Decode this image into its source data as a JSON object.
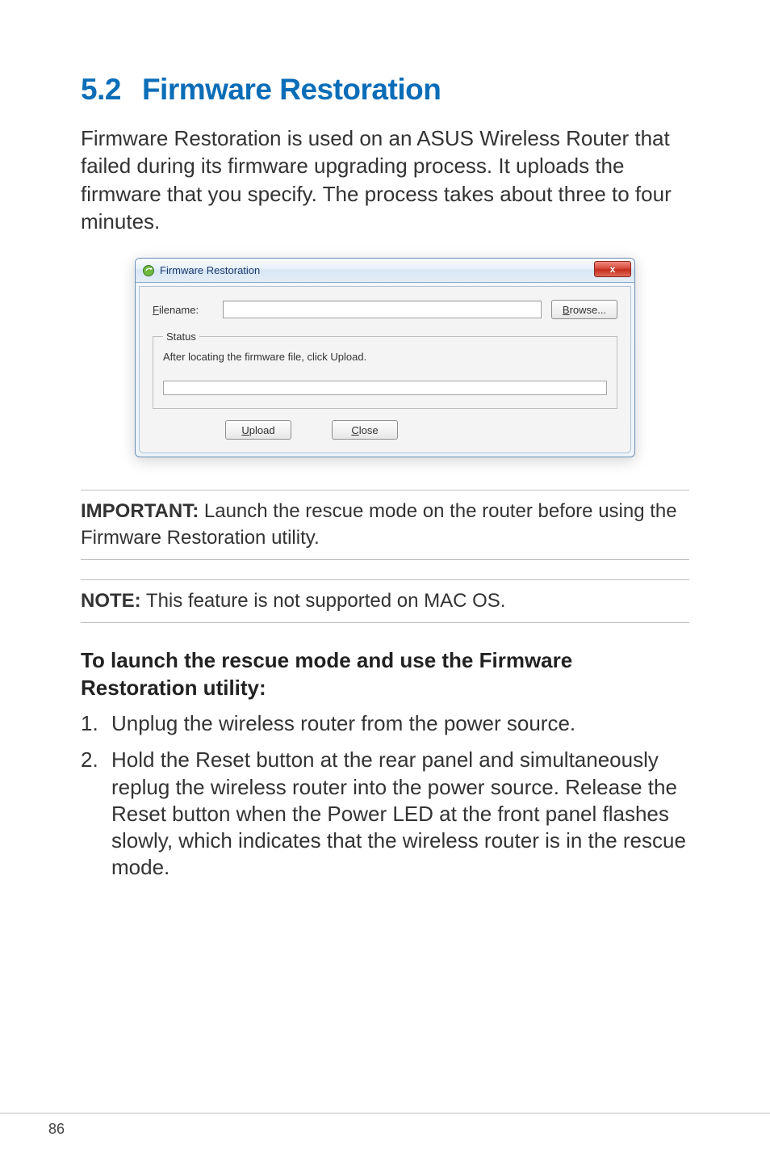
{
  "heading": {
    "number": "5.2",
    "title": "Firmware Restoration"
  },
  "intro": "Firmware Restoration is used on an ASUS Wireless Router that failed during its firmware upgrading process. It uploads the firmware that you specify. The process takes about three to four minutes.",
  "dialog": {
    "title": "Firmware Restoration",
    "close_glyph": "x",
    "filename_label_pre": "F",
    "filename_label_post": "ilename:",
    "filename_value": "",
    "browse_pre": "B",
    "browse_post": "rowse...",
    "status_legend": "Status",
    "status_text": "After locating the firmware file, click Upload.",
    "upload_pre": "U",
    "upload_post": "pload",
    "close_pre": "C",
    "close_post": "lose"
  },
  "important": {
    "label": "IMPORTANT:",
    "text": "  Launch the rescue mode on the router before using the Firmware Restoration utility."
  },
  "note": {
    "label": "NOTE:",
    "text": "  This feature is not supported on MAC OS."
  },
  "subheading": "To launch the rescue mode and use the Firmware Restoration utility:",
  "steps": [
    "Unplug the wireless router from the power source.",
    "Hold the Reset button at the rear panel and simultaneously replug the wireless router into the power source. Release the Reset button when the Power LED at the front panel flashes slowly, which indicates that the wireless router is in the rescue mode."
  ],
  "page_number": "86"
}
